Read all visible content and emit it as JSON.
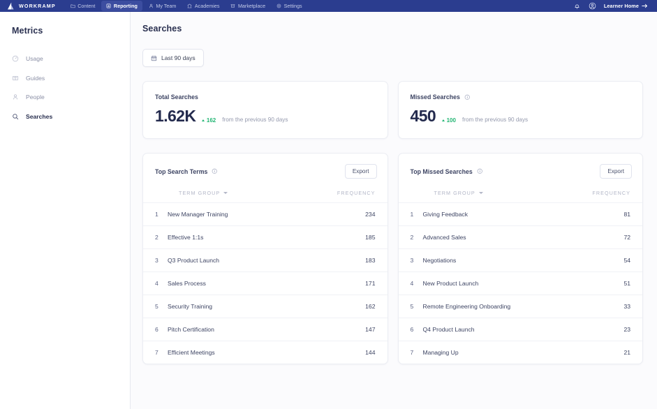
{
  "topbar": {
    "brand": "WORKRAMP",
    "brand_icon": "workramp-mountain-logo",
    "nav": [
      {
        "label": "Content",
        "icon": "folder-icon",
        "active": false
      },
      {
        "label": "Reporting",
        "icon": "report-document-icon",
        "active": true
      },
      {
        "label": "My Team",
        "icon": "people-icon",
        "active": false
      },
      {
        "label": "Academies",
        "icon": "bank-icon",
        "active": false
      },
      {
        "label": "Marketplace",
        "icon": "shop-icon",
        "active": false
      },
      {
        "label": "Settings",
        "icon": "gear-icon",
        "active": false
      }
    ],
    "notifications_icon": "bell-icon",
    "account_icon": "user-avatar-icon",
    "learner_home": "Learner Home",
    "learner_home_icon": "arrow-right-icon",
    "bg_color": "#2b3d8f",
    "active_pill_color": "#3c4da0"
  },
  "sidebar": {
    "title": "Metrics",
    "items": [
      {
        "label": "Usage",
        "icon": "gauge-icon",
        "active": false
      },
      {
        "label": "Guides",
        "icon": "book-icon",
        "active": false
      },
      {
        "label": "People",
        "icon": "person-icon",
        "active": false
      },
      {
        "label": "Searches",
        "icon": "search-icon",
        "active": true
      }
    ]
  },
  "main": {
    "page_title": "Searches",
    "date_filter": {
      "label": "Last 90 days",
      "icon": "calendar-icon"
    },
    "kpis": [
      {
        "label": "Total Searches",
        "has_info": false,
        "value": "1.62K",
        "delta": "162",
        "delta_direction": "up",
        "delta_color": "#22b573",
        "comparison": "from the previous 90 days"
      },
      {
        "label": "Missed Searches",
        "has_info": true,
        "info_icon": "info-icon",
        "value": "450",
        "delta": "100",
        "delta_direction": "up",
        "delta_color": "#22b573",
        "comparison": "from the previous 90 days"
      }
    ],
    "tables": [
      {
        "title": "Top Search Terms",
        "info_icon": "info-icon",
        "export_label": "Export",
        "columns": {
          "term": "TERM GROUP",
          "frequency": "FREQUENCY"
        },
        "sort_icon": "caret-down-icon",
        "rows": [
          {
            "rank": "1",
            "term": "New Manager Training",
            "frequency": "234"
          },
          {
            "rank": "2",
            "term": "Effective 1:1s",
            "frequency": "185"
          },
          {
            "rank": "3",
            "term": "Q3 Product Launch",
            "frequency": "183"
          },
          {
            "rank": "4",
            "term": "Sales Process",
            "frequency": "171"
          },
          {
            "rank": "5",
            "term": "Security Training",
            "frequency": "162"
          },
          {
            "rank": "6",
            "term": "Pitch Certification",
            "frequency": "147"
          },
          {
            "rank": "7",
            "term": "Efficient Meetings",
            "frequency": "144"
          }
        ]
      },
      {
        "title": "Top Missed Searches",
        "info_icon": "info-icon",
        "export_label": "Export",
        "columns": {
          "term": "TERM GROUP",
          "frequency": "FREQUENCY"
        },
        "sort_icon": "caret-down-icon",
        "rows": [
          {
            "rank": "1",
            "term": "Giving Feedback",
            "frequency": "81"
          },
          {
            "rank": "2",
            "term": "Advanced Sales",
            "frequency": "72"
          },
          {
            "rank": "3",
            "term": "Negotiations",
            "frequency": "54"
          },
          {
            "rank": "4",
            "term": "New Product Launch",
            "frequency": "51"
          },
          {
            "rank": "5",
            "term": "Remote Engineering Onboarding",
            "frequency": "33"
          },
          {
            "rank": "6",
            "term": "Q4 Product Launch",
            "frequency": "23"
          },
          {
            "rank": "7",
            "term": "Managing Up",
            "frequency": "21"
          }
        ]
      }
    ]
  }
}
